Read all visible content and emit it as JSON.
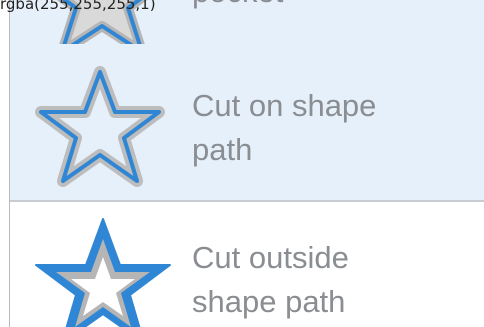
{
  "debug_text": "rgba(255,255,255,1)",
  "options": [
    {
      "label": "pocket",
      "icon": "star-pocket-icon",
      "selected": true
    },
    {
      "label": "Cut on shape\npath",
      "icon": "star-on-path-icon",
      "selected": true
    },
    {
      "label": "Cut outside\nshape path",
      "icon": "star-outside-icon",
      "selected": false
    }
  ],
  "colors": {
    "selected_background": "#e6f0fb",
    "unselected_background": "#ffffff",
    "label_text": "#8a8d91",
    "icon_blue": "#2f86d4",
    "icon_gray": "#b5b5b5"
  }
}
